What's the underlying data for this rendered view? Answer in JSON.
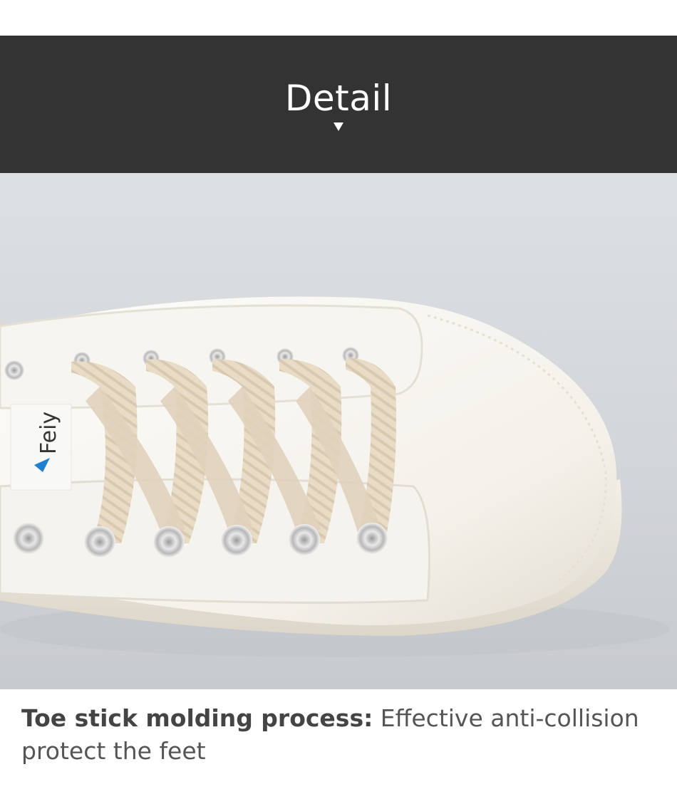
{
  "banner": {
    "title": "Detail",
    "indicator_icon": "caret-down-icon",
    "background_color": "#333333",
    "text_color": "#ffffff"
  },
  "photo": {
    "subject": "white canvas sneaker toe with beige laces",
    "logo_text": "Feiy",
    "background_color": "#d6d9dc",
    "lace_color": "#e6d9c4",
    "canvas_color": "#fbfaf7"
  },
  "caption": {
    "bold_text": "Toe stick molding process:",
    "text": " Effective anti-collision protect the feet"
  }
}
